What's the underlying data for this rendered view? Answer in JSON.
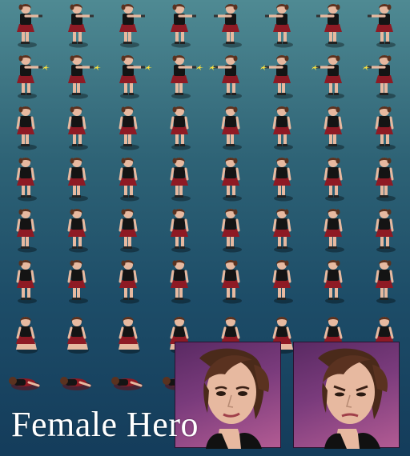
{
  "title": "Female Hero",
  "colors": {
    "bg_top": "#4f8a93",
    "bg_bottom": "#143c5b",
    "skin": "#e7b9a0",
    "hair": "#5a3220",
    "top": "#141414",
    "skirt": "#8e1a24",
    "shoes": "#222222",
    "muzzle_flash": "#ffe23a",
    "portrait_bg": "#6b3370"
  },
  "sprite_sheet": {
    "columns": 8,
    "rows": [
      {
        "name": "aim",
        "muzzle_flash": false
      },
      {
        "name": "shoot",
        "muzzle_flash": true
      },
      {
        "name": "idle",
        "muzzle_flash": false
      },
      {
        "name": "walk-1",
        "muzzle_flash": false
      },
      {
        "name": "walk-2",
        "muzzle_flash": false
      },
      {
        "name": "walk-3",
        "muzzle_flash": false
      },
      {
        "name": "kneel",
        "muzzle_flash": false
      },
      {
        "name": "dead",
        "muzzle_flash": false
      }
    ]
  },
  "portraits": [
    {
      "name": "portrait-neutral"
    },
    {
      "name": "portrait-angry"
    }
  ]
}
